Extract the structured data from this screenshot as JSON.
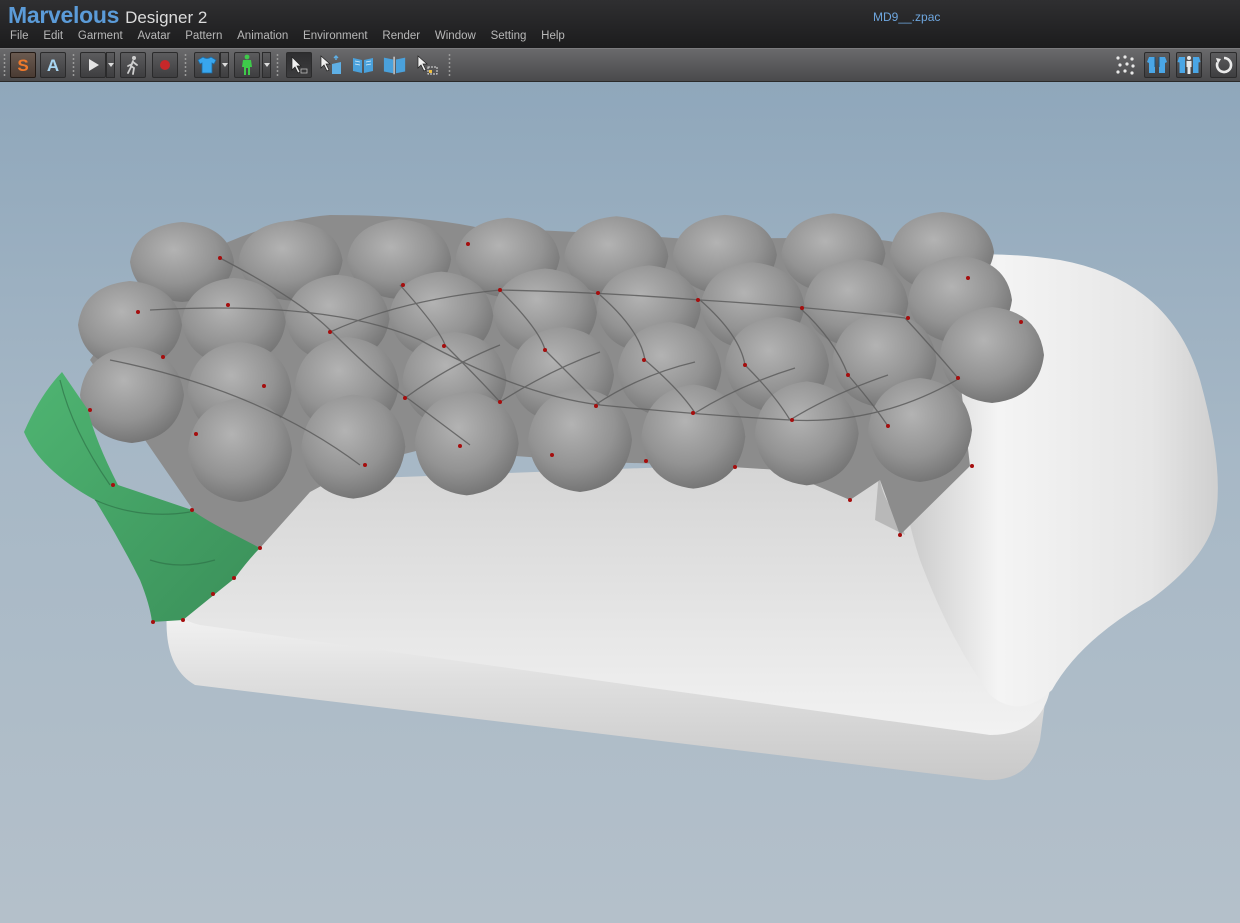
{
  "window": {
    "brand": "Marvelous",
    "product": "Designer 2",
    "file_name": "MD9__.zpac"
  },
  "menu": {
    "items": [
      "File",
      "Edit",
      "Garment",
      "Avatar",
      "Pattern",
      "Animation",
      "Environment",
      "Render",
      "Window",
      "Setting",
      "Help"
    ]
  },
  "toolbar": {
    "simulation_label": "S",
    "animation_label": "A"
  },
  "colors": {
    "brand_blue": "#5b9bd8",
    "simulation_orange": "#e8742a",
    "animation_blue": "#9fd0f0",
    "garment_gray": "#8e8e8e",
    "selected_pattern_green": "#4aa56a",
    "sofa_white": "#e9e9e9",
    "pin_red": "#b01010"
  }
}
